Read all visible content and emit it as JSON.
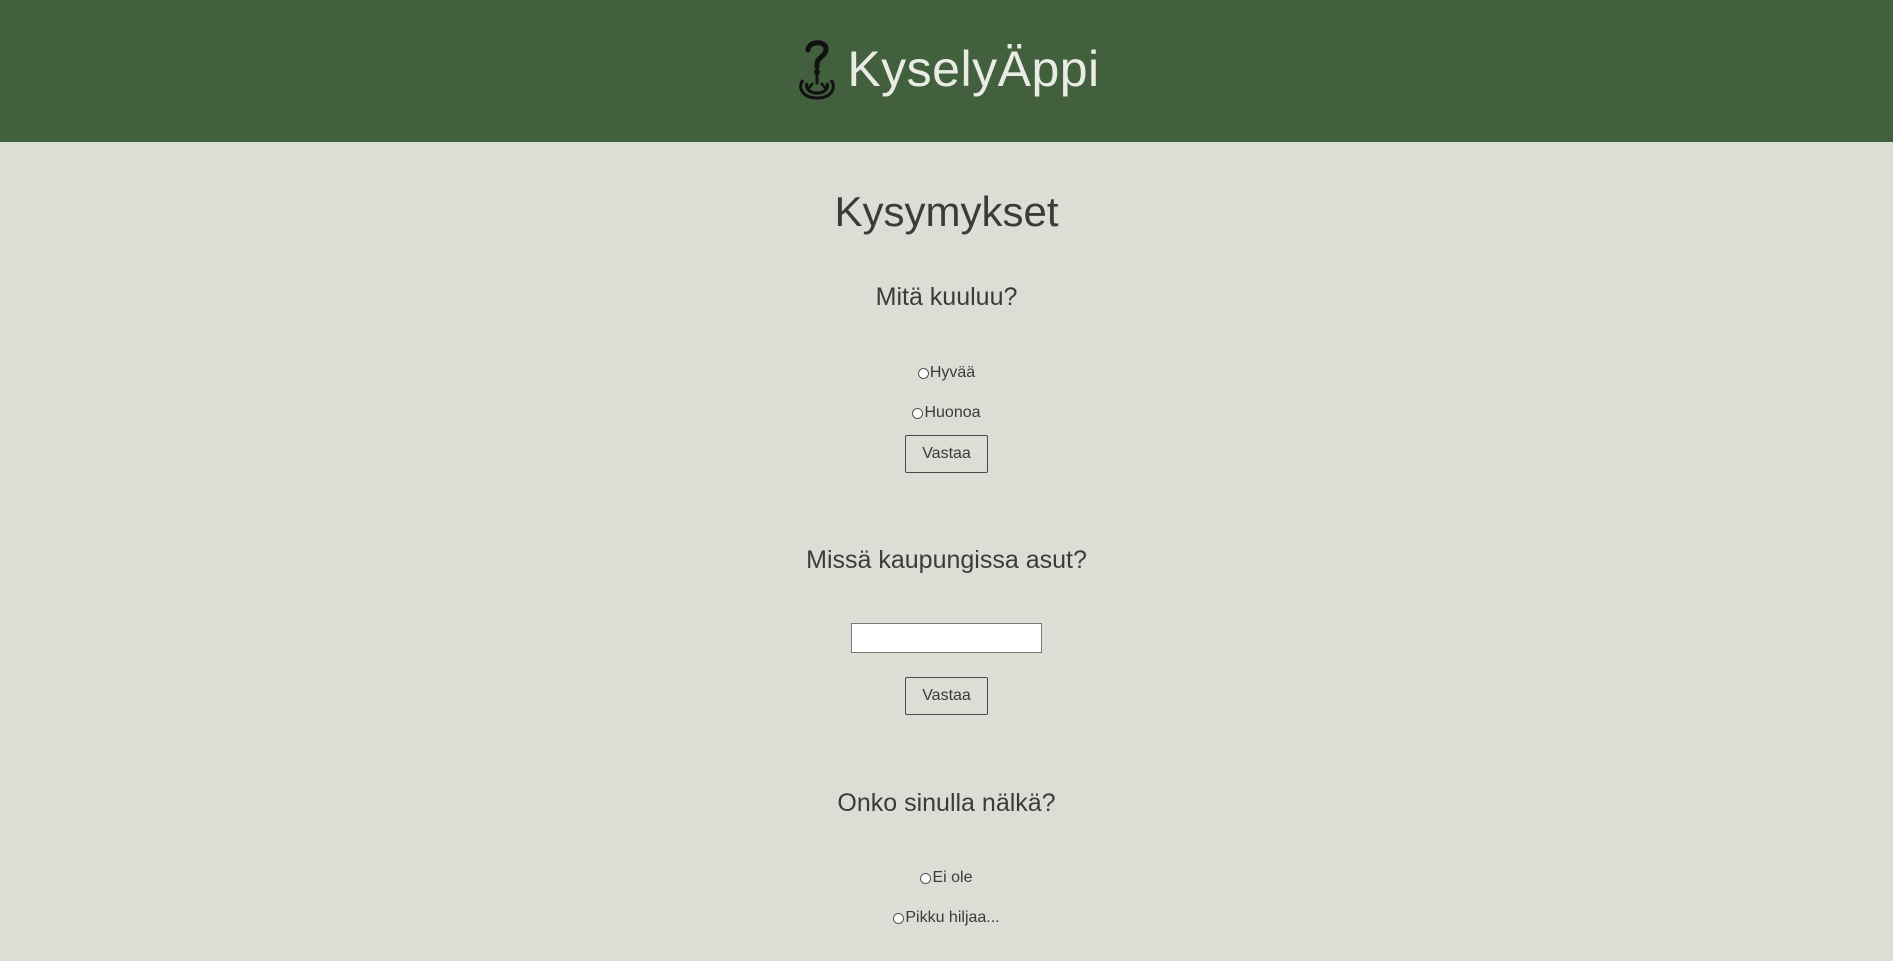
{
  "header": {
    "app_title": "KyselyÄppi",
    "logo_icon": "question-hand-logo-icon",
    "background_color": "#42603d"
  },
  "main": {
    "page_title": "Kysymykset",
    "background_color": "#dbded5",
    "questions": [
      {
        "title": "Mitä kuuluu?",
        "type": "radio",
        "options": [
          "Hyvää",
          "Huonoa"
        ],
        "submit_label": "Vastaa"
      },
      {
        "title": "Missä kaupungissa asut?",
        "type": "text",
        "value": "",
        "placeholder": "",
        "submit_label": "Vastaa"
      },
      {
        "title": "Onko sinulla nälkä?",
        "type": "radio",
        "options": [
          "Ei ole",
          "Pikku hiljaa..."
        ]
      }
    ]
  }
}
